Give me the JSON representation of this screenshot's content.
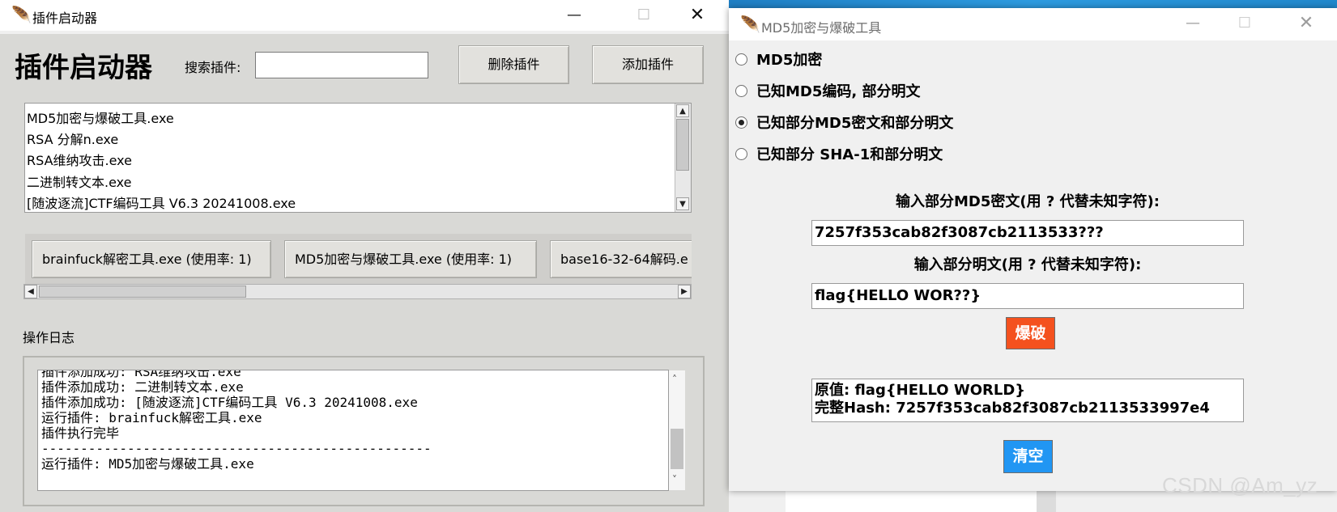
{
  "left_window": {
    "title": "插件启动器",
    "heading": "插件启动器",
    "search_label": "搜索插件:",
    "search_value": "",
    "delete_button": "删除插件",
    "add_button": "添加插件",
    "plugin_list": [
      "MD5加密与爆破工具.exe",
      "RSA 分解n.exe",
      "RSA维纳攻击.exe",
      "二进制转文本.exe",
      "[随波逐流]CTF编码工具 V6.3 20241008.exe"
    ],
    "recent_buttons": [
      "brainfuck解密工具.exe (使用率: 1)",
      "MD5加密与爆破工具.exe (使用率: 1)",
      "base16-32-64解码.e"
    ],
    "log_label": "操作日志",
    "log_lines": [
      "插件添加成功: RSA维纳攻击.exe",
      "插件添加成功: 二进制转文本.exe",
      "插件添加成功: [随波逐流]CTF编码工具 V6.3 20241008.exe",
      "运行插件: brainfuck解密工具.exe",
      "插件执行完毕",
      "--------------------------------------------------",
      "运行插件: MD5加密与爆破工具.exe"
    ]
  },
  "right_window": {
    "title": "MD5加密与爆破工具",
    "modes": [
      {
        "label": "MD5加密",
        "selected": false
      },
      {
        "label": "已知MD5编码, 部分明文",
        "selected": false
      },
      {
        "label": "已知部分MD5密文和部分明文",
        "selected": true
      },
      {
        "label": "已知部分 SHA-1和部分明文",
        "selected": false
      }
    ],
    "cipher_label": "输入部分MD5密文(用 ? 代替未知字符):",
    "cipher_value": "7257f353cab82f3087cb2113533???",
    "plain_label": "输入部分明文(用 ? 代替未知字符):",
    "plain_value": "flag{HELLO WOR??}",
    "crack_button": "爆破",
    "result_lines": [
      "原值: flag{HELLO WORLD}",
      "完整Hash: 7257f353cab82f3087cb2113533997e4"
    ],
    "clear_button": "清空"
  },
  "desktop": {
    "watermark": "CSDN @Am_yz"
  },
  "colors": {
    "crack_button": "#f4511e",
    "clear_button": "#2196f3"
  },
  "icons": [
    "feather-icon",
    "minimize-icon",
    "maximize-icon",
    "close-icon",
    "arrow-up-icon",
    "arrow-down-icon",
    "arrow-left-icon",
    "arrow-right-icon"
  ]
}
